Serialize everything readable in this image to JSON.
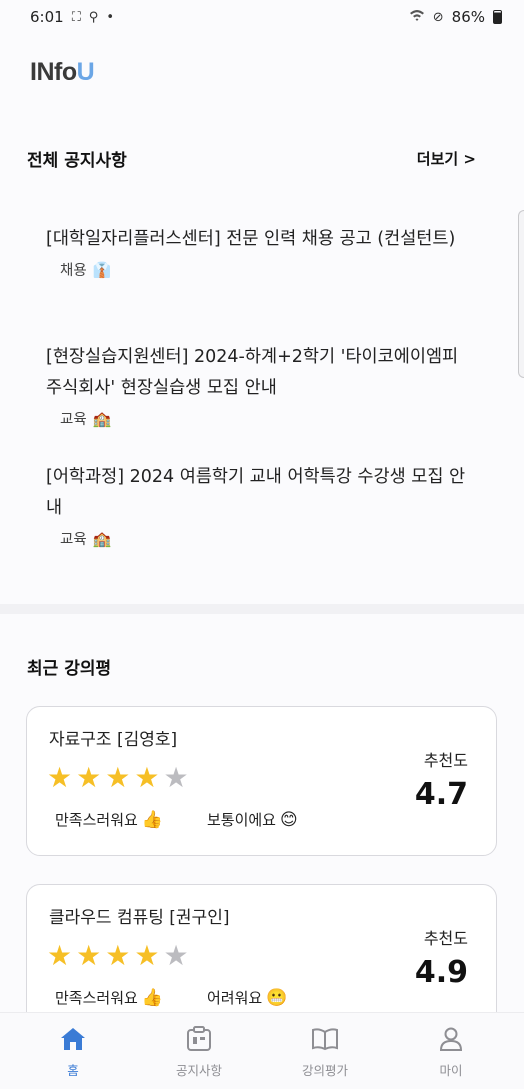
{
  "status_bar": {
    "time": "6:01",
    "battery": "86%"
  },
  "app": {
    "logo_main": "INfo",
    "logo_accent": "U"
  },
  "notices": {
    "title": "전체 공지사항",
    "more": "더보기 >",
    "items": [
      {
        "title": "[대학일자리플러스센터] 전문 인력 채용 공고 (컨설턴트)",
        "tag": "채용",
        "icon": "necktie-icon"
      },
      {
        "title": "[현장실습지원센터] 2024-하계+2학기 '타이코에이엠피 주식회사' 현장실습생 모집 안내",
        "tag": "교육",
        "icon": "school-icon"
      },
      {
        "title": "[어학과정] 2024 여름학기 교내 어학특강 수강생 모집 안내",
        "tag": "교육",
        "icon": "school-icon"
      }
    ]
  },
  "reviews": {
    "title": "최근 강의평",
    "rec_label": "추천도",
    "items": [
      {
        "course": "자료구조 [김영호]",
        "stars": 4,
        "opinion1": "만족스러워요",
        "opinion1_emoji": "👍",
        "opinion2": "보통이에요",
        "opinion2_emoji": "😊",
        "score": "4.7"
      },
      {
        "course": "클라우드 컴퓨팅 [권구인]",
        "stars": 4,
        "opinion1": "만족스러워요",
        "opinion1_emoji": "👍",
        "opinion2": "어려워요",
        "opinion2_emoji": "😬",
        "score": "4.9"
      }
    ]
  },
  "tabs": [
    {
      "label": "홈",
      "icon": "home-icon",
      "active": true
    },
    {
      "label": "공지사항",
      "icon": "notice-board-icon",
      "active": false
    },
    {
      "label": "강의평가",
      "icon": "book-icon",
      "active": false
    },
    {
      "label": "마이",
      "icon": "person-icon",
      "active": false
    }
  ],
  "colors": {
    "accent": "#3a7bd5",
    "star_on": "#f6bf26",
    "star_off": "#bcbcc0"
  }
}
